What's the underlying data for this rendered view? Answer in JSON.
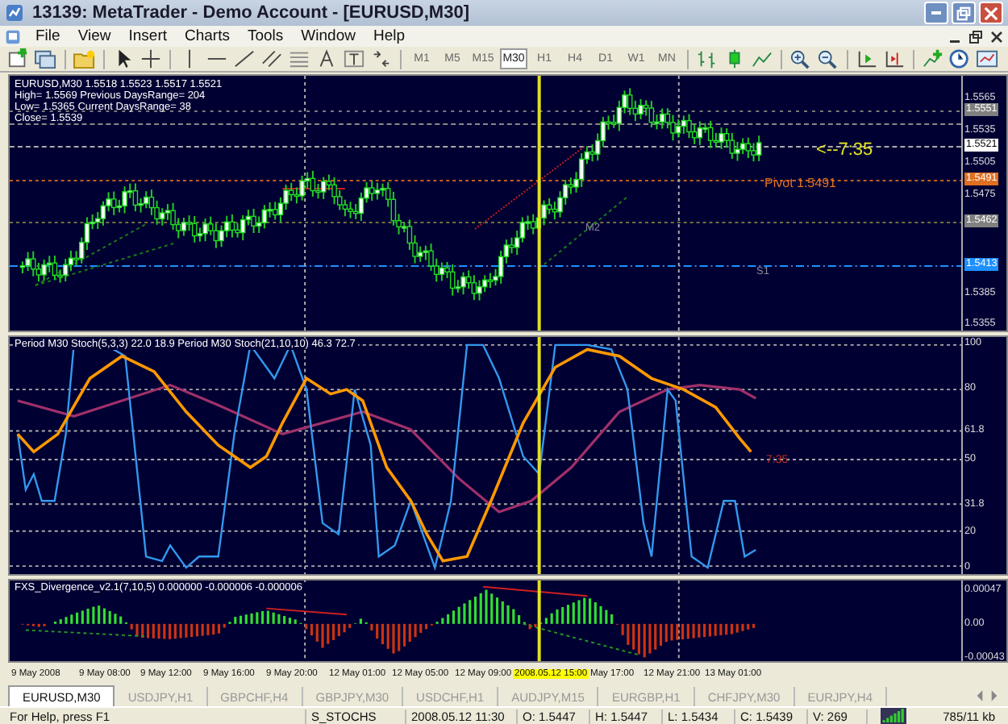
{
  "window": {
    "title": "13139: MetaTrader - Demo Account - [EURUSD,M30]"
  },
  "menu": [
    "File",
    "View",
    "Insert",
    "Charts",
    "Tools",
    "Window",
    "Help"
  ],
  "timeframes": [
    {
      "label": "M1",
      "selected": false
    },
    {
      "label": "M5",
      "selected": false
    },
    {
      "label": "M15",
      "selected": false
    },
    {
      "label": "M30",
      "selected": true
    },
    {
      "label": "H1",
      "selected": false
    },
    {
      "label": "H4",
      "selected": false
    },
    {
      "label": "D1",
      "selected": false
    },
    {
      "label": "W1",
      "selected": false
    },
    {
      "label": "MN",
      "selected": false
    }
  ],
  "main_chart": {
    "info_lines": [
      "EURUSD,M30  1.5518 1.5523 1.5517 1.5521",
      "High= 1.5569 Previous DaysRange= 204",
      "Low= 1.5365 Current DaysRange= 38",
      "Close= 1.5539"
    ],
    "price_labels": [
      {
        "text": "1.5565",
        "kind": "tick"
      },
      {
        "text": "1.5551",
        "kind": "marker",
        "color": "#808080"
      },
      {
        "text": "1.5535",
        "kind": "tick"
      },
      {
        "text": "1.5521",
        "kind": "marker",
        "color": "#ffffff"
      },
      {
        "text": "1.5505",
        "kind": "tick"
      },
      {
        "text": "1.5491",
        "kind": "marker",
        "color": "#e07020"
      },
      {
        "text": "1.5475",
        "kind": "tick"
      },
      {
        "text": "1.5462",
        "kind": "marker",
        "color": "#808080"
      },
      {
        "text": "1.5413",
        "kind": "marker",
        "color": "#1e90ff"
      },
      {
        "text": "1.5385",
        "kind": "tick"
      },
      {
        "text": "1.5355",
        "kind": "tick"
      }
    ],
    "countdown": "<--7:35",
    "pivot": "Pivot  1.5491",
    "level_labels": [
      "M2",
      "S1"
    ]
  },
  "stoch_panel": {
    "label": "Period M30 Stoch(5,3,3) 22.0 18.9  Period M30 Stoch(21,10,10) 46.3 72.7",
    "levels": [
      "100",
      "80",
      "61.8",
      "50",
      "31.8",
      "20",
      "0"
    ],
    "countdown": "7:35"
  },
  "divergence_panel": {
    "label": "FXS_Divergence_v2.1(7,10,5) 0.000000 -0.000006 -0.000006",
    "levels": [
      "0.00047",
      "0.00",
      "-0.00043"
    ]
  },
  "time_axis": [
    {
      "text": "9 May 2008",
      "selected": false
    },
    {
      "text": "9 May 08:00",
      "selected": false
    },
    {
      "text": "9 May 12:00",
      "selected": false
    },
    {
      "text": "9 May 16:00",
      "selected": false
    },
    {
      "text": "9 May 20:00",
      "selected": false
    },
    {
      "text": "12 May 01:00",
      "selected": false
    },
    {
      "text": "12 May 05:00",
      "selected": false
    },
    {
      "text": "12 May 09:00",
      "selected": false
    },
    {
      "text": "2008.05.12 15:00",
      "selected": true
    },
    {
      "text": "May 17:00",
      "selected": false
    },
    {
      "text": "12 May 21:00",
      "selected": false
    },
    {
      "text": "13 May 01:00",
      "selected": false
    }
  ],
  "tabs": [
    {
      "label": "EURUSD,M30",
      "selected": true
    },
    {
      "label": "USDJPY,H1",
      "selected": false
    },
    {
      "label": "GBPCHF,H4",
      "selected": false
    },
    {
      "label": "GBPJPY,M30",
      "selected": false
    },
    {
      "label": "USDCHF,H1",
      "selected": false
    },
    {
      "label": "AUDJPY,M15",
      "selected": false
    },
    {
      "label": "EURGBP,H1",
      "selected": false
    },
    {
      "label": "CHFJPY,M30",
      "selected": false
    },
    {
      "label": "EURJPY,H4",
      "selected": false
    }
  ],
  "status_bar": {
    "help": "For Help, press F1",
    "template": "S_STOCHS",
    "time": "2008.05.12 11:30",
    "open": "O: 1.5447",
    "high": "H: 1.5447",
    "low": "L: 1.5434",
    "close": "C: 1.5439",
    "volume": "V: 269",
    "traffic": "785/11 kb"
  }
}
